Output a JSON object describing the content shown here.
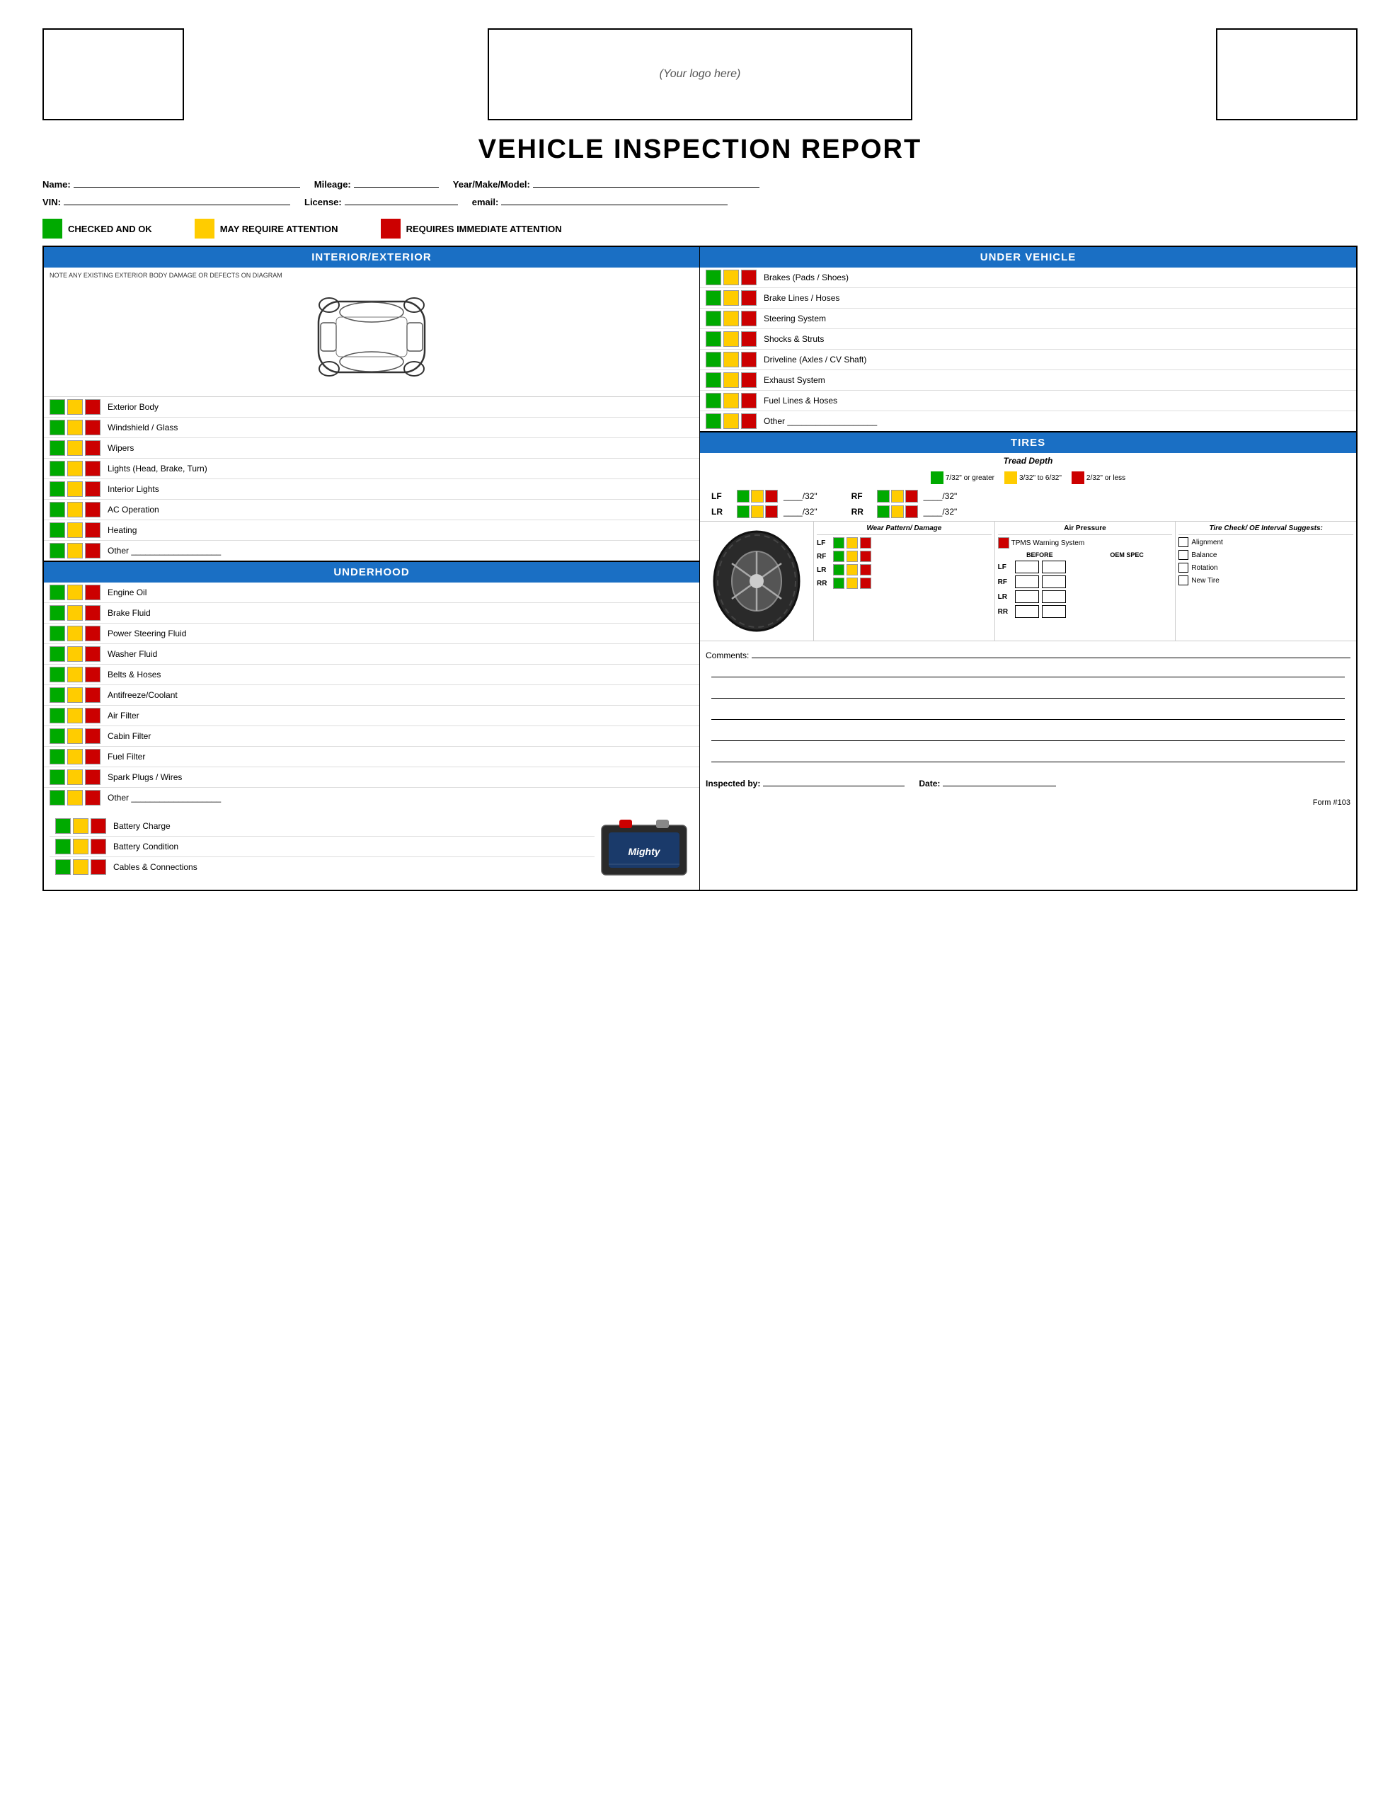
{
  "header": {
    "logo_placeholder": "(Your logo here)",
    "title": "VEHICLE INSPECTION REPORT"
  },
  "form_fields": {
    "name_label": "Name:",
    "mileage_label": "Mileage:",
    "year_make_model_label": "Year/Make/Model:",
    "vin_label": "VIN:",
    "license_label": "License:",
    "email_label": "email:"
  },
  "legend": {
    "checked_ok": "CHECKED AND OK",
    "may_require": "MAY REQUIRE ATTENTION",
    "requires_immediate": "REQUIRES IMMEDIATE ATTENTION"
  },
  "interior_exterior": {
    "title": "INTERIOR/EXTERIOR",
    "note": "NOTE ANY EXISTING EXTERIOR BODY DAMAGE OR DEFECTS ON DIAGRAM",
    "items": [
      "Exterior Body",
      "Windshield / Glass",
      "Wipers",
      "Lights (Head, Brake, Turn)",
      "Interior Lights",
      "AC Operation",
      "Heating",
      "Other ___________________"
    ]
  },
  "underhood": {
    "title": "UNDERHOOD",
    "items": [
      "Engine Oil",
      "Brake Fluid",
      "Power Steering Fluid",
      "Washer Fluid",
      "Belts & Hoses",
      "Antifreeze/Coolant",
      "Air Filter",
      "Cabin Filter",
      "Fuel Filter",
      "Spark Plugs / Wires",
      "Other ___________________"
    ],
    "battery_items": [
      "Battery Charge",
      "Battery Condition",
      "Cables & Connections"
    ]
  },
  "under_vehicle": {
    "title": "UNDER VEHICLE",
    "items": [
      "Brakes (Pads / Shoes)",
      "Brake Lines / Hoses",
      "Steering System",
      "Shocks & Struts",
      "Driveline (Axles / CV Shaft)",
      "Exhaust System",
      "Fuel Lines & Hoses",
      "Other ___________________"
    ]
  },
  "tires": {
    "title": "TIRES",
    "tread_depth_title": "Tread Depth",
    "tread_legend": [
      {
        "color": "green",
        "label": "7/32\" or greater"
      },
      {
        "color": "yellow",
        "label": "3/32\" to 6/32\""
      },
      {
        "color": "red",
        "label": "2/32\" or less"
      }
    ],
    "positions": [
      "LF",
      "RF",
      "LR",
      "RR"
    ],
    "wear_pattern_header": "Wear Pattern/ Damage",
    "air_pressure_header": "Air Pressure",
    "tpms_label": "TPMS Warning System",
    "before_label": "BEFORE",
    "oem_spec_label": "OEM SPEC",
    "tire_check_header": "Tire Check/ OE Interval Suggests:",
    "tire_check_items": [
      "Alignment",
      "Balance",
      "Rotation",
      "New Tire"
    ]
  },
  "comments": {
    "label": "Comments:",
    "lines": 5
  },
  "inspector": {
    "inspected_by_label": "Inspected by:",
    "date_label": "Date:"
  },
  "form_number": "Form #103"
}
